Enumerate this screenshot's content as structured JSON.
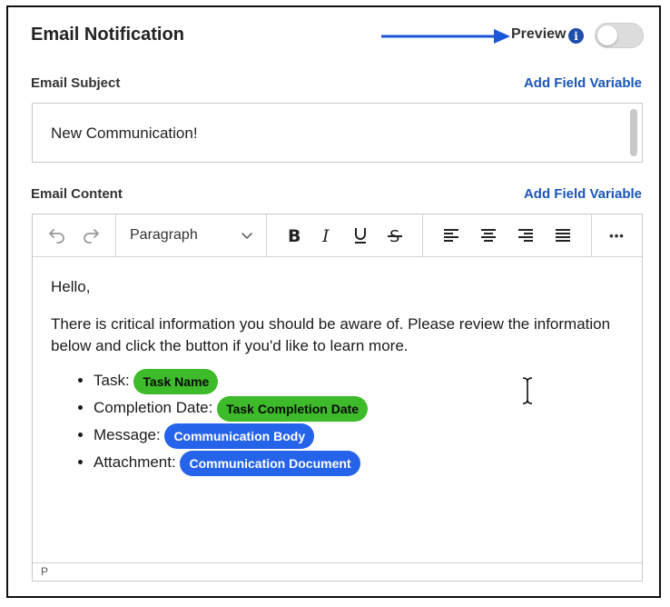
{
  "header": {
    "title": "Email Notification",
    "preview_label": "Preview",
    "preview_on": false
  },
  "subject": {
    "label": "Email Subject",
    "add_variable_label": "Add Field Variable",
    "value": "New Communication!"
  },
  "content": {
    "label": "Email Content",
    "add_variable_label": "Add Field Variable",
    "toolbar": {
      "block_format": "Paragraph",
      "more_label": "•••"
    },
    "greeting": "Hello,",
    "intro": "There is critical information you should be aware of. Please review the information below and click the button if you'd like to learn more.",
    "items": [
      {
        "label": "Task:",
        "variable": "Task Name",
        "color": "green"
      },
      {
        "label": "Completion Date:",
        "variable": "Task Completion Date",
        "color": "green"
      },
      {
        "label": "Message:",
        "variable": "Communication Body",
        "color": "blue"
      },
      {
        "label": "Attachment:",
        "variable": "Communication Document",
        "color": "blue"
      }
    ],
    "status_path": "P"
  },
  "colors": {
    "link": "#1a56b8",
    "arrow": "#1a56d8",
    "pill_green": "#3dbb2a",
    "pill_blue": "#2563eb"
  }
}
